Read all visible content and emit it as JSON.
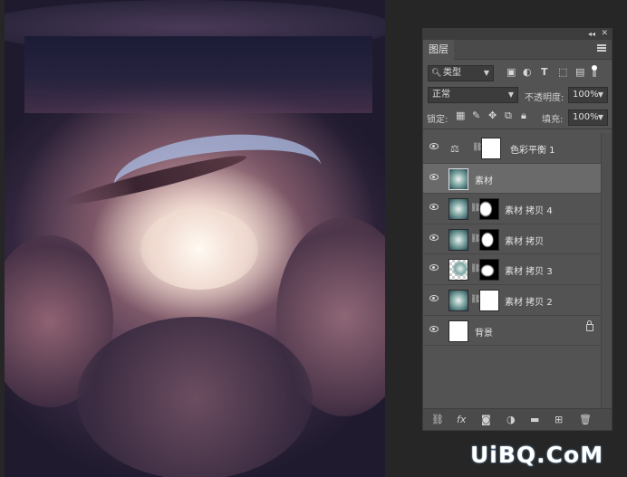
{
  "panel": {
    "tab_label": "图层",
    "filter": {
      "value": "类型"
    },
    "blend_mode": {
      "value": "正常"
    },
    "opacity": {
      "label": "不透明度:",
      "value": "100%"
    },
    "lock": {
      "label": "锁定:"
    },
    "fill": {
      "label": "填充:",
      "value": "100%"
    },
    "layers": [
      {
        "name": "色彩平衡 1",
        "kind": "adjustment",
        "icon": "balance-scale-icon",
        "thumb": "white-mask"
      },
      {
        "name": "素材",
        "kind": "image",
        "selected": true
      },
      {
        "name": "素材 拷贝 4",
        "kind": "image-with-mask"
      },
      {
        "name": "素材 拷贝",
        "kind": "image-with-mask"
      },
      {
        "name": "素材 拷贝 3",
        "kind": "image-with-mask"
      },
      {
        "name": "素材 拷贝 2",
        "kind": "image-with-mask"
      },
      {
        "name": "背景",
        "kind": "background",
        "locked": true
      }
    ]
  },
  "watermark": "UiBQ.CoM",
  "colors": {
    "panel": "#535353",
    "selected_row": "#6a6a6a",
    "dark_bar": "#3c3c3c"
  }
}
